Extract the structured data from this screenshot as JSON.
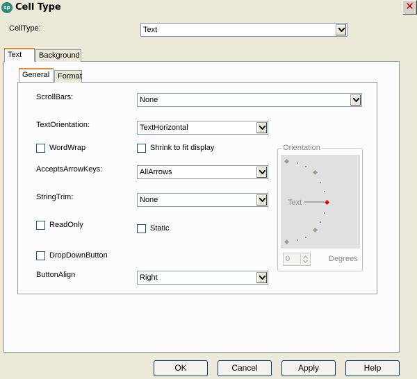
{
  "window": {
    "title": "Cell Type",
    "icon_text": "sp"
  },
  "celltype": {
    "label": "CellType:",
    "value": "Text"
  },
  "outer_tabs": [
    {
      "label": "Text"
    },
    {
      "label": "Background"
    }
  ],
  "inner_tabs": [
    {
      "label": "General"
    },
    {
      "label": "Format"
    }
  ],
  "general": {
    "scrollbars_label": "ScrollBars:",
    "scrollbars_value": "None",
    "textorientation_label": "TextOrientation:",
    "textorientation_value": "TextHorizontal",
    "wordwrap_label": "WordWrap",
    "shrink_label": "Shrink to fit display",
    "acceptsarrowkeys_label": "AcceptsArrowKeys:",
    "acceptsarrowkeys_value": "AllArrows",
    "stringtrim_label": "StringTrim:",
    "stringtrim_value": "None",
    "readonly_label": "ReadOnly",
    "static_label": "Static",
    "dropdownbutton_label": "DropDownButton",
    "buttonalign_label": "ButtonAlign",
    "buttonalign_value": "Right"
  },
  "orientation": {
    "group_label": "Orientation",
    "text_label": "Text",
    "degrees_value": "0",
    "degrees_label": "Degrees"
  },
  "buttons": {
    "ok": "OK",
    "cancel": "Cancel",
    "apply": "Apply",
    "help": "Help"
  }
}
